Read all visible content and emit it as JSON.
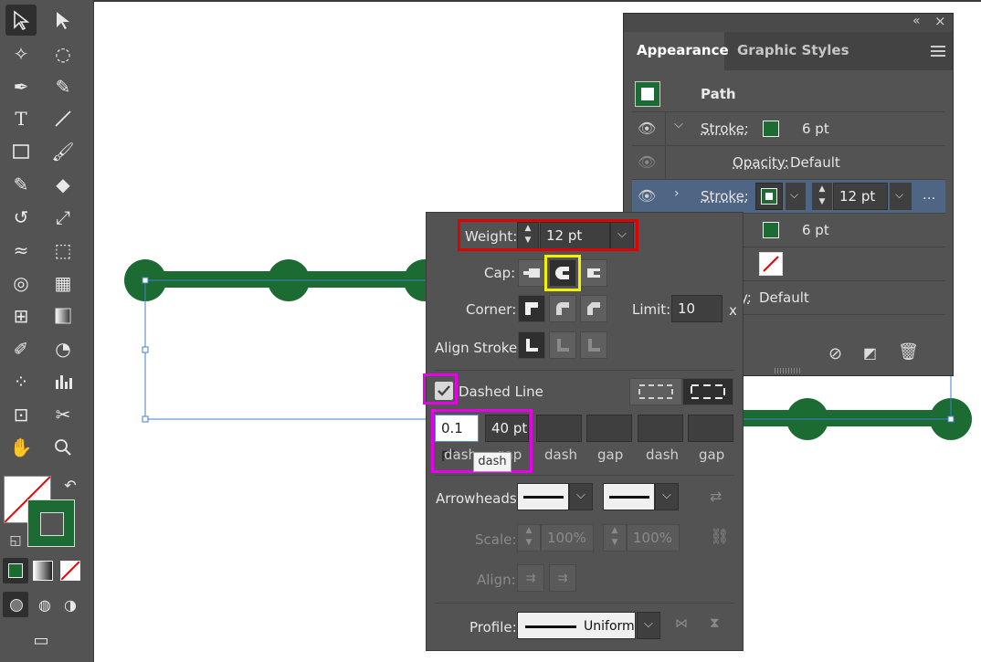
{
  "appearance_panel": {
    "collapse_glyph": "«",
    "close_glyph": "×",
    "tabs": [
      {
        "label": "Appearance"
      },
      {
        "label": "Graphic Styles"
      }
    ],
    "menu_icon": "hamburger-menu-icon",
    "object_label": "Path",
    "rows": [
      {
        "label": "Stroke:",
        "value": "6 pt"
      },
      {
        "label": "Opacity:",
        "value": "Default"
      },
      {
        "label": "Stroke:",
        "value": "12 pt"
      },
      {
        "value": "6 pt"
      },
      {
        "label": "Opacity:",
        "value": "Default"
      }
    ],
    "more": "...",
    "opacity_partial": "y:"
  },
  "stroke_panel": {
    "weight_label": "Weight:",
    "weight_value": "12 pt",
    "cap_label": "Cap:",
    "corner_label": "Corner:",
    "limit_label": "Limit:",
    "limit_value": "10",
    "limit_unit": "x",
    "align_label": "Align Stroke:",
    "dashed_label": "Dashed Line",
    "dash_fields": [
      {
        "value": "0.1 pt",
        "label": "dash"
      },
      {
        "value": "40 pt",
        "label": "gap"
      },
      {
        "value": "",
        "label": "dash"
      },
      {
        "value": "",
        "label": "gap"
      },
      {
        "value": "",
        "label": "dash"
      },
      {
        "value": "",
        "label": "gap"
      }
    ],
    "tooltip": "dash",
    "arrowheads_label": "Arrowheads:",
    "scale_label": "Scale:",
    "scale_start": "100%",
    "scale_end": "100%",
    "align_arrow_label": "Align:",
    "profile_label": "Profile:",
    "profile_value": "Uniform"
  },
  "colors": {
    "accent_green": "#1b6b32",
    "highlight_red": "#e00000",
    "highlight_yellow": "#f2f200",
    "highlight_magenta": "#e800e8"
  }
}
